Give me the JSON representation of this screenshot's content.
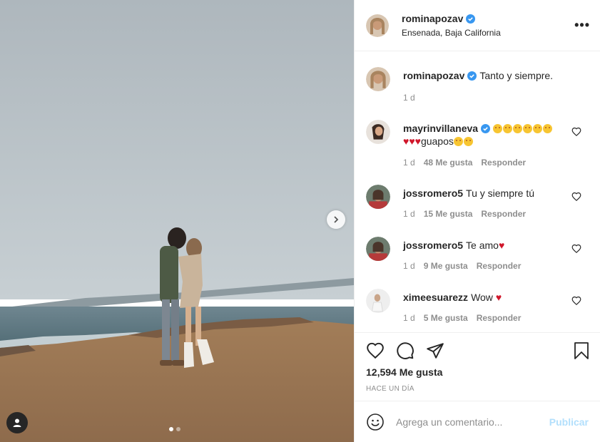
{
  "post": {
    "author": "rominapozav",
    "location": "Ensenada, Baja California",
    "caption": "Tanto y siempre.",
    "caption_time": "1 d"
  },
  "comments": [
    {
      "user": "mayrinvillaneva",
      "verified": true,
      "text_suffix": "guapos",
      "time": "1 d",
      "likes": "48 Me gusta",
      "reply": "Responder"
    },
    {
      "user": "jossromero5",
      "verified": false,
      "text": "Tu y siempre tú",
      "time": "1 d",
      "likes": "15 Me gusta",
      "reply": "Responder"
    },
    {
      "user": "jossromero5",
      "verified": false,
      "text": "Te amo",
      "time": "1 d",
      "likes": "9 Me gusta",
      "reply": "Responder"
    },
    {
      "user": "ximeesuarezz",
      "verified": false,
      "text": "Wow",
      "time": "1 d",
      "likes": "5 Me gusta",
      "reply": "Responder"
    }
  ],
  "stats": {
    "likes": "12,594 Me gusta",
    "time_ago": "HACE UN DÍA"
  },
  "composer": {
    "placeholder": "Agrega un comentario...",
    "publish_label": "Publicar"
  },
  "carousel": {
    "current": 1,
    "total": 2
  },
  "icons": [
    "more-options-icon",
    "verified-badge-icon",
    "heart-icon",
    "comment-icon",
    "share-icon",
    "save-icon",
    "emoji-icon",
    "chevron-right-icon",
    "user-tag-icon"
  ],
  "colors": {
    "verified": "#3897f0",
    "publish_disabled": "#b2dffc",
    "heart_red": "#ed4956"
  }
}
